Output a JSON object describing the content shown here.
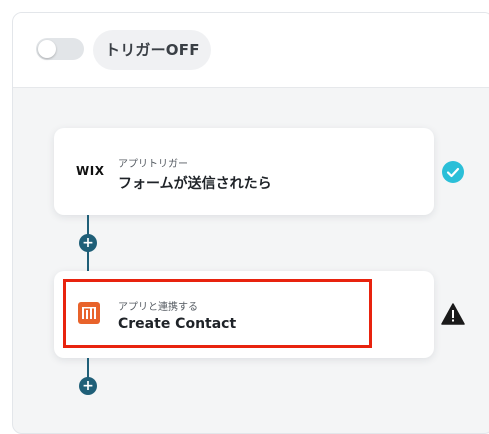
{
  "trigger": {
    "toggle_state": "off",
    "label": "トリガーOFF"
  },
  "steps": [
    {
      "logo_text": "WIX",
      "type_label": "アプリトリガー",
      "title": "フォームが送信されたら",
      "status_icon": "check-circle-icon",
      "status_color": "#2bbfd8"
    },
    {
      "logo_icon": "hubspot-like-orange-app-icon",
      "logo_color": "#e8632b",
      "type_label": "アプリと連携する",
      "title": "Create Contact",
      "status_icon": "warning-triangle-icon",
      "status_color": "#1a1a1a",
      "highlight_color": "#e8230e"
    }
  ],
  "connector_color": "#1f5f78"
}
